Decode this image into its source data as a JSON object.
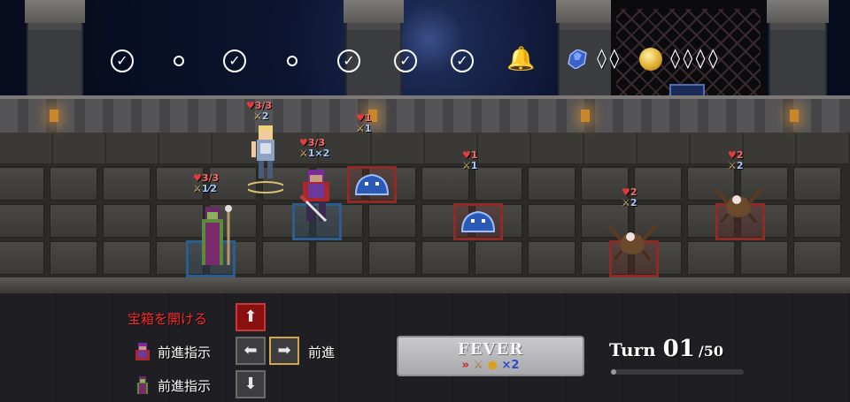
{
  "progress": {
    "stages": [
      "cleared",
      "pending",
      "cleared",
      "pending",
      "cleared",
      "cleared",
      "cleared",
      "boss"
    ]
  },
  "resources": {
    "gems": "◊◊",
    "coins": "◊◊◊◊"
  },
  "units": [
    {
      "id": "knight",
      "hp": "3/3",
      "atk": "2"
    },
    {
      "id": "warrior",
      "hp": "3/3",
      "atk": "1",
      "mult": "2"
    },
    {
      "id": "mage",
      "hp": "3/3",
      "atk": "1",
      "mult": "2"
    },
    {
      "id": "slime-a",
      "hp": "1",
      "atk": "1"
    },
    {
      "id": "slime-b",
      "hp": "1",
      "atk": "1"
    },
    {
      "id": "crab-a",
      "hp": "2",
      "atk": "2"
    },
    {
      "id": "crab-b",
      "hp": "2",
      "atk": "2"
    }
  ],
  "commands": {
    "open_chest": "宝箱を開ける",
    "advance_order_1": "前進指示",
    "advance_order_2": "前進指示",
    "advance": "前進"
  },
  "fever": {
    "title": "FEVER",
    "multiplier": "2"
  },
  "turn": {
    "label": "Turn",
    "current": "01",
    "max": "50",
    "progress": 0.02
  },
  "colors": {
    "hp": "#ff6a6a",
    "attack": "#9fc8ff",
    "enemy_highlight": "#8e2b28",
    "ally_highlight": "#2c5d8c",
    "command_red": "#ff2a2a"
  }
}
